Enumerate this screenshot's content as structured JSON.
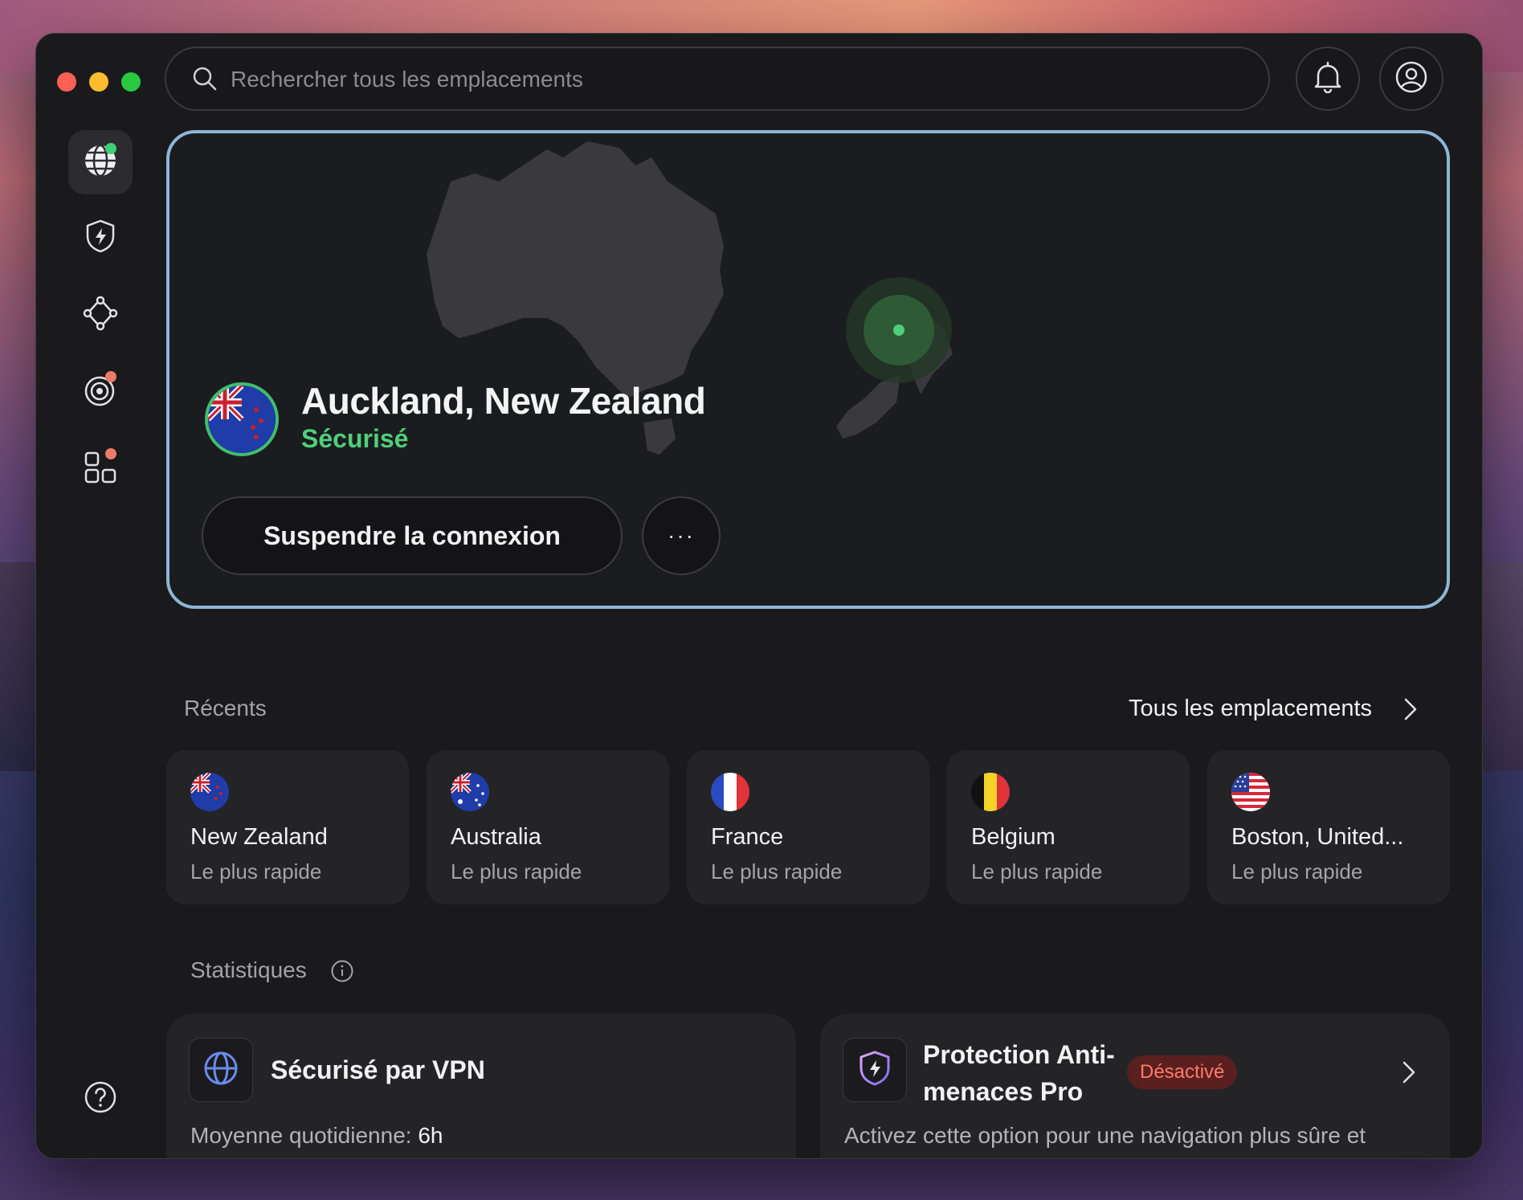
{
  "window": {
    "traffic_lights": [
      "close",
      "minimize",
      "zoom"
    ]
  },
  "search": {
    "placeholder": "Rechercher tous les emplacements",
    "value": ""
  },
  "sidebar": {
    "items": [
      {
        "name": "vpn-globe",
        "icon": "globe-icon",
        "active": true,
        "badge_color": "#3fcf73"
      },
      {
        "name": "threat-protection",
        "icon": "shield-bolt-icon",
        "active": false
      },
      {
        "name": "meshnet",
        "icon": "mesh-network-icon",
        "active": false
      },
      {
        "name": "dark-web-monitor",
        "icon": "radar-icon",
        "active": false,
        "badge_color": "#ee7a6a"
      },
      {
        "name": "apps",
        "icon": "apps-grid-icon",
        "active": false,
        "badge_color": "#ee7a6a"
      }
    ],
    "help_icon": "help-icon"
  },
  "hero": {
    "location": "Auckland, New Zealand",
    "status": "Sécurisé",
    "pause_label": "Suspendre la connexion",
    "more_label": "···",
    "status_color": "#4fcf7a",
    "border_color": "#8cb6d8"
  },
  "recents": {
    "label": "Récents",
    "all_locations_label": "Tous les emplacements",
    "items": [
      {
        "name": "New Zealand",
        "sub": "Le plus rapide",
        "flag": "nz"
      },
      {
        "name": "Australia",
        "sub": "Le plus rapide",
        "flag": "au"
      },
      {
        "name": "France",
        "sub": "Le plus rapide",
        "flag": "fr"
      },
      {
        "name": "Belgium",
        "sub": "Le plus rapide",
        "flag": "be"
      },
      {
        "name": "Boston, United...",
        "sub": "Le plus rapide",
        "flag": "us"
      }
    ]
  },
  "stats": {
    "label": "Statistiques",
    "vpn_card": {
      "title": "Sécurisé par VPN",
      "avg_label": "Moyenne quotidienne:",
      "avg_value": "6h"
    },
    "threat_card": {
      "title_line1": "Protection Anti-",
      "title_line2": "menaces Pro",
      "badge": "Désactivé",
      "text": "Activez cette option pour une navigation plus sûre et"
    }
  }
}
